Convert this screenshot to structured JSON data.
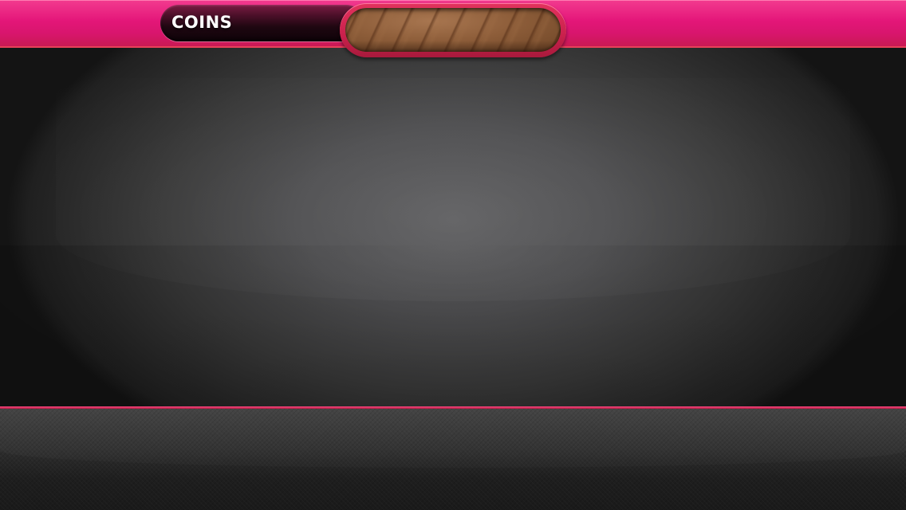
{
  "hud": {
    "coins_label": "COINS"
  },
  "colors": {
    "top_bar": "#e5177a",
    "frame_accent": "#c9204c",
    "wood": "#8e5e3a",
    "stage": "#4e4e50",
    "bottom_panel": "#2a2a2a"
  }
}
